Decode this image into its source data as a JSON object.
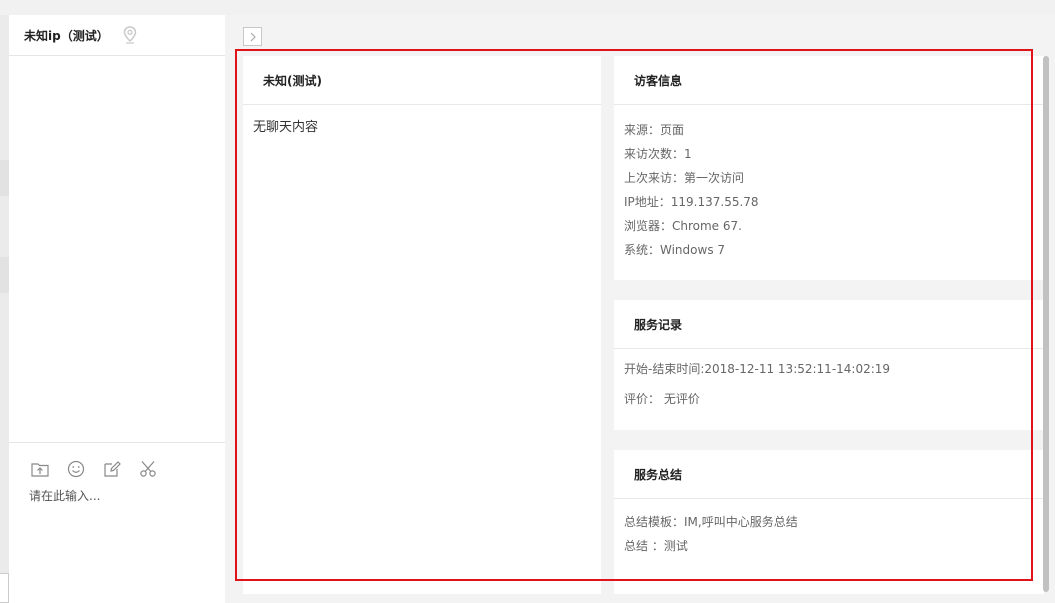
{
  "chat": {
    "title": "未知ip（测试）",
    "input_placeholder": "请在此输入...",
    "toolbar_icons": [
      "folder-upload-icon",
      "emoji-icon",
      "edit-icon",
      "scissors-icon"
    ]
  },
  "visitor": {
    "title": "未知(测试)",
    "empty_text": "无聊天内容"
  },
  "info": {
    "title": "访客信息",
    "lines": [
      "来源：页面",
      "来访次数：1",
      "上次来访：第一次访问",
      "IP地址：119.137.55.78",
      "浏览器：Chrome 67.",
      "系统：Windows 7"
    ]
  },
  "record": {
    "title": "服务记录",
    "time": "开始-结束时间:2018-12-11 13:52:11-14:02:19",
    "rating": "评价：  无评价"
  },
  "summary": {
    "title": "服务总结",
    "lines": [
      "总结模板：IM,呼叫中心服务总结",
      "总结        ：测试"
    ]
  },
  "colors": {
    "highlight": "#e0121a"
  }
}
